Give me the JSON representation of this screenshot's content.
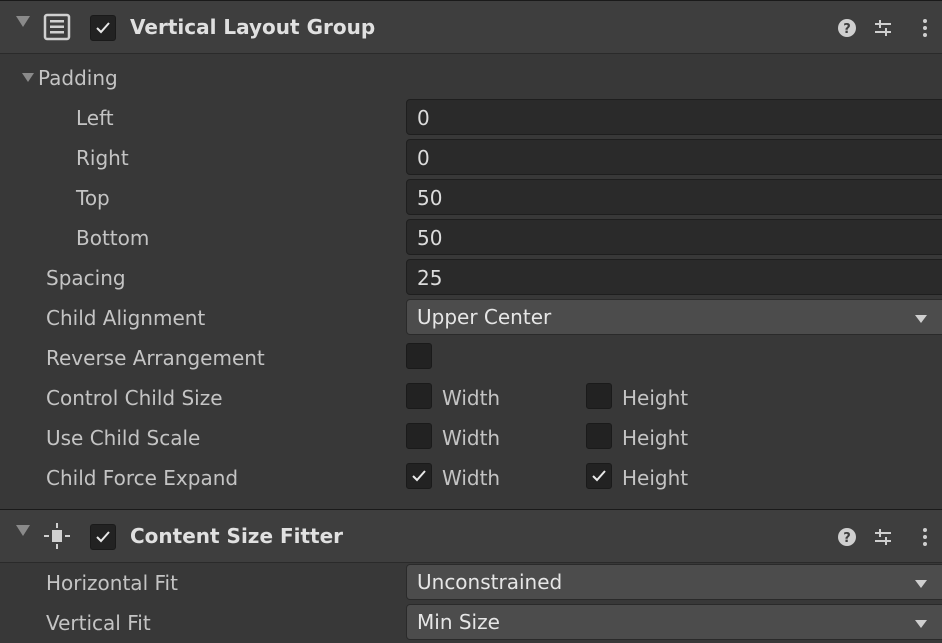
{
  "vertical_layout_group": {
    "title": "Vertical Layout Group",
    "enabled": true,
    "icons": {
      "component": "vertical-layout-group-icon",
      "help": "help-icon",
      "presets": "presets-icon",
      "menu": "kebab-menu-icon"
    },
    "padding": {
      "label": "Padding",
      "left_label": "Left",
      "left_value": "0",
      "right_label": "Right",
      "right_value": "0",
      "top_label": "Top",
      "top_value": "50",
      "bottom_label": "Bottom",
      "bottom_value": "50"
    },
    "spacing": {
      "label": "Spacing",
      "value": "25"
    },
    "child_alignment": {
      "label": "Child Alignment",
      "value": "Upper Center"
    },
    "reverse_arrangement": {
      "label": "Reverse Arrangement",
      "checked": false
    },
    "control_child_size": {
      "label": "Control Child Size",
      "width_label": "Width",
      "width_checked": false,
      "height_label": "Height",
      "height_checked": false
    },
    "use_child_scale": {
      "label": "Use Child Scale",
      "width_label": "Width",
      "width_checked": false,
      "height_label": "Height",
      "height_checked": false
    },
    "child_force_expand": {
      "label": "Child Force Expand",
      "width_label": "Width",
      "width_checked": true,
      "height_label": "Height",
      "height_checked": true
    }
  },
  "content_size_fitter": {
    "title": "Content Size Fitter",
    "enabled": true,
    "icons": {
      "component": "content-size-fitter-icon",
      "help": "help-icon",
      "presets": "presets-icon",
      "menu": "kebab-menu-icon"
    },
    "horizontal_fit": {
      "label": "Horizontal Fit",
      "value": "Unconstrained"
    },
    "vertical_fit": {
      "label": "Vertical Fit",
      "value": "Min Size"
    }
  },
  "colors": {
    "panel_bg": "#383838",
    "header_bg": "#3e3e3e",
    "field_bg": "#2a2a2a",
    "dropdown_bg": "#4c4c4c",
    "text": "#c4c4c4"
  }
}
